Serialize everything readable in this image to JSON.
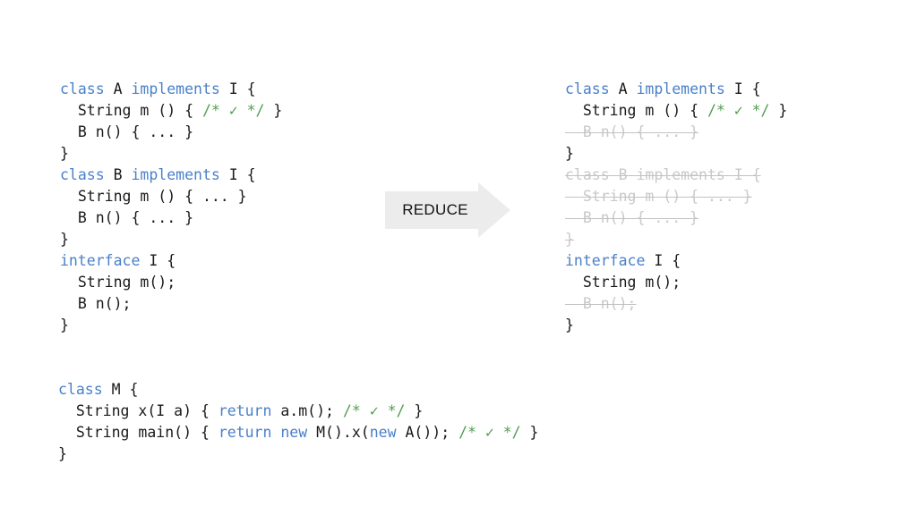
{
  "page": {
    "background_color": "#ffffff",
    "keyword_color": "#4a80c8",
    "comment_color": "#4f9e4f",
    "text_color": "#1a1a1a",
    "deleted_color": "#c9c9c9",
    "arrow_color": "#ececec"
  },
  "arrow": {
    "label": "REDUCE"
  },
  "before": {
    "lines": [
      {
        "deleted": false,
        "spans": [
          {
            "t": "class ",
            "c": "kw"
          },
          {
            "t": "A ",
            "c": "plain"
          },
          {
            "t": "implements ",
            "c": "kw"
          },
          {
            "t": "I {",
            "c": "plain"
          }
        ]
      },
      {
        "deleted": false,
        "spans": [
          {
            "t": "  String m () { ",
            "c": "plain"
          },
          {
            "t": "/* ✓ */",
            "c": "cmt"
          },
          {
            "t": " }",
            "c": "plain"
          }
        ]
      },
      {
        "deleted": false,
        "spans": [
          {
            "t": "  B n() { ... }",
            "c": "plain"
          }
        ]
      },
      {
        "deleted": false,
        "spans": [
          {
            "t": "}",
            "c": "plain"
          }
        ]
      },
      {
        "deleted": false,
        "spans": [
          {
            "t": "class ",
            "c": "kw"
          },
          {
            "t": "B ",
            "c": "plain"
          },
          {
            "t": "implements ",
            "c": "kw"
          },
          {
            "t": "I {",
            "c": "plain"
          }
        ]
      },
      {
        "deleted": false,
        "spans": [
          {
            "t": "  String m () { ... }",
            "c": "plain"
          }
        ]
      },
      {
        "deleted": false,
        "spans": [
          {
            "t": "  B n() { ... }",
            "c": "plain"
          }
        ]
      },
      {
        "deleted": false,
        "spans": [
          {
            "t": "}",
            "c": "plain"
          }
        ]
      },
      {
        "deleted": false,
        "spans": [
          {
            "t": "interface ",
            "c": "kw"
          },
          {
            "t": "I {",
            "c": "plain"
          }
        ]
      },
      {
        "deleted": false,
        "spans": [
          {
            "t": "  String m();",
            "c": "plain"
          }
        ]
      },
      {
        "deleted": false,
        "spans": [
          {
            "t": "  B n();",
            "c": "plain"
          }
        ]
      },
      {
        "deleted": false,
        "spans": [
          {
            "t": "}",
            "c": "plain"
          }
        ]
      }
    ]
  },
  "after": {
    "lines": [
      {
        "deleted": false,
        "spans": [
          {
            "t": "class ",
            "c": "kw"
          },
          {
            "t": "A ",
            "c": "plain"
          },
          {
            "t": "implements ",
            "c": "kw"
          },
          {
            "t": "I {",
            "c": "plain"
          }
        ]
      },
      {
        "deleted": false,
        "spans": [
          {
            "t": "  String m () { ",
            "c": "plain"
          },
          {
            "t": "/* ✓ */",
            "c": "cmt"
          },
          {
            "t": " }",
            "c": "plain"
          }
        ]
      },
      {
        "deleted": true,
        "spans": [
          {
            "t": "  B n() { ... }",
            "c": "plain"
          }
        ]
      },
      {
        "deleted": false,
        "spans": [
          {
            "t": "}",
            "c": "plain"
          }
        ]
      },
      {
        "deleted": true,
        "spans": [
          {
            "t": "class ",
            "c": "kw"
          },
          {
            "t": "B ",
            "c": "plain"
          },
          {
            "t": "implements ",
            "c": "kw"
          },
          {
            "t": "I {",
            "c": "plain"
          }
        ]
      },
      {
        "deleted": true,
        "spans": [
          {
            "t": "  String m () { ... }",
            "c": "plain"
          }
        ]
      },
      {
        "deleted": true,
        "spans": [
          {
            "t": "  B n() { ... }",
            "c": "plain"
          }
        ]
      },
      {
        "deleted": true,
        "spans": [
          {
            "t": "}",
            "c": "plain"
          }
        ]
      },
      {
        "deleted": false,
        "spans": [
          {
            "t": "interface ",
            "c": "kw"
          },
          {
            "t": "I {",
            "c": "plain"
          }
        ]
      },
      {
        "deleted": false,
        "spans": [
          {
            "t": "  String m();",
            "c": "plain"
          }
        ]
      },
      {
        "deleted": true,
        "spans": [
          {
            "t": "  B n();",
            "c": "plain"
          }
        ]
      },
      {
        "deleted": false,
        "spans": [
          {
            "t": "}",
            "c": "plain"
          }
        ]
      }
    ]
  },
  "main_class": {
    "lines": [
      {
        "deleted": false,
        "spans": [
          {
            "t": "class ",
            "c": "kw"
          },
          {
            "t": "M {",
            "c": "plain"
          }
        ]
      },
      {
        "deleted": false,
        "spans": [
          {
            "t": "  String x(I a) { ",
            "c": "plain"
          },
          {
            "t": "return ",
            "c": "kw"
          },
          {
            "t": "a.m(); ",
            "c": "plain"
          },
          {
            "t": "/* ✓ */",
            "c": "cmt"
          },
          {
            "t": " }",
            "c": "plain"
          }
        ]
      },
      {
        "deleted": false,
        "spans": [
          {
            "t": "  String main() { ",
            "c": "plain"
          },
          {
            "t": "return ",
            "c": "kw"
          },
          {
            "t": "new ",
            "c": "kw"
          },
          {
            "t": "M().x(",
            "c": "plain"
          },
          {
            "t": "new ",
            "c": "kw"
          },
          {
            "t": "A()); ",
            "c": "plain"
          },
          {
            "t": "/* ✓ */",
            "c": "cmt"
          },
          {
            "t": " }",
            "c": "plain"
          }
        ]
      },
      {
        "deleted": false,
        "spans": [
          {
            "t": "}",
            "c": "plain"
          }
        ]
      }
    ]
  }
}
